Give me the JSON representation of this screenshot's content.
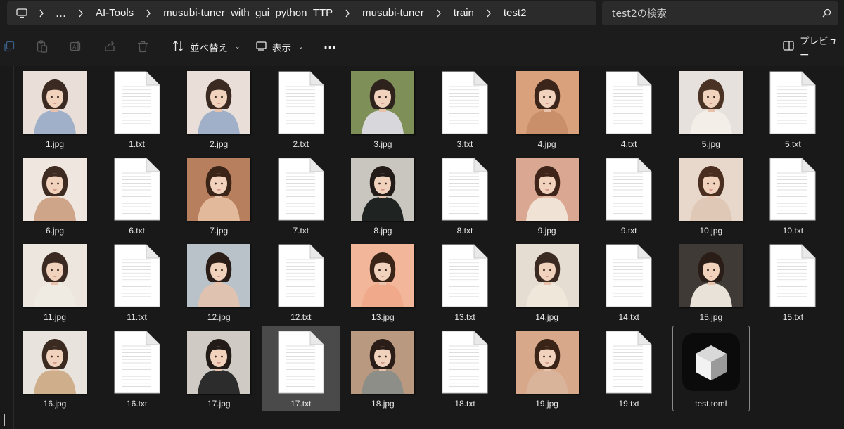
{
  "address": {
    "overflow_label": "…",
    "crumbs": [
      "AI-Tools",
      "musubi-tuner_with_gui_python_TTP",
      "musubi-tuner",
      "train",
      "test2"
    ]
  },
  "search": {
    "placeholder": "test2の検索"
  },
  "toolbar": {
    "sort_label": "並べ替え",
    "view_label": "表示",
    "more_label": "···",
    "preview_label": "プレビュー"
  },
  "files": [
    {
      "name": "1.jpg",
      "type": "image",
      "bg": "#e9dfd8",
      "cloth": "#9fb0c8",
      "hair": "#3a2a22"
    },
    {
      "name": "1.txt",
      "type": "text"
    },
    {
      "name": "2.jpg",
      "type": "image",
      "bg": "#e9dfd8",
      "cloth": "#9fb0c8",
      "hair": "#3a2a22"
    },
    {
      "name": "2.txt",
      "type": "text"
    },
    {
      "name": "3.jpg",
      "type": "image",
      "bg": "#7f8f58",
      "cloth": "#d8d8dc",
      "hair": "#2d221c"
    },
    {
      "name": "3.txt",
      "type": "text"
    },
    {
      "name": "4.jpg",
      "type": "image",
      "bg": "#d9a27c",
      "cloth": "#c98e6a",
      "hair": "#3b2419"
    },
    {
      "name": "4.txt",
      "type": "text"
    },
    {
      "name": "5.jpg",
      "type": "image",
      "bg": "#e6e1dc",
      "cloth": "#f3efe8",
      "hair": "#4a3325"
    },
    {
      "name": "5.txt",
      "type": "text"
    },
    {
      "name": "6.jpg",
      "type": "image",
      "bg": "#efe6df",
      "cloth": "#cfa58a",
      "hair": "#3d2a20"
    },
    {
      "name": "6.txt",
      "type": "text"
    },
    {
      "name": "7.jpg",
      "type": "image",
      "bg": "#b87f5e",
      "cloth": "#e2b99a",
      "hair": "#3a2418"
    },
    {
      "name": "7.txt",
      "type": "text"
    },
    {
      "name": "8.jpg",
      "type": "image",
      "bg": "#c9c6c0",
      "cloth": "#1f2422",
      "hair": "#231b17"
    },
    {
      "name": "8.txt",
      "type": "text"
    },
    {
      "name": "9.jpg",
      "type": "image",
      "bg": "#d9a792",
      "cloth": "#f1e2d6",
      "hair": "#3f2419"
    },
    {
      "name": "9.txt",
      "type": "text"
    },
    {
      "name": "10.jpg",
      "type": "image",
      "bg": "#e8d8cc",
      "cloth": "#e0c8b6",
      "hair": "#4a2e20"
    },
    {
      "name": "10.txt",
      "type": "text"
    },
    {
      "name": "11.jpg",
      "type": "image",
      "bg": "#ece6de",
      "cloth": "#f0ebe2",
      "hair": "#3a2a22"
    },
    {
      "name": "11.txt",
      "type": "text"
    },
    {
      "name": "12.jpg",
      "type": "image",
      "bg": "#b9c2c9",
      "cloth": "#e0c2b0",
      "hair": "#2a1c16"
    },
    {
      "name": "12.txt",
      "type": "text"
    },
    {
      "name": "13.jpg",
      "type": "image",
      "bg": "#f2b79a",
      "cloth": "#f0a98a",
      "hair": "#3a2418"
    },
    {
      "name": "13.txt",
      "type": "text"
    },
    {
      "name": "14.jpg",
      "type": "image",
      "bg": "#e6ddd2",
      "cloth": "#eee7da",
      "hair": "#3a2a22"
    },
    {
      "name": "14.txt",
      "type": "text"
    },
    {
      "name": "15.jpg",
      "type": "image",
      "bg": "#3f3a36",
      "cloth": "#e8e2d8",
      "hair": "#2a1c16"
    },
    {
      "name": "15.txt",
      "type": "text"
    },
    {
      "name": "16.jpg",
      "type": "image",
      "bg": "#e8e3dc",
      "cloth": "#cfae8c",
      "hair": "#3b2a20"
    },
    {
      "name": "16.txt",
      "type": "text"
    },
    {
      "name": "17.jpg",
      "type": "image",
      "bg": "#cfcac4",
      "cloth": "#2c2c2c",
      "hair": "#231b17"
    },
    {
      "name": "17.txt",
      "type": "text",
      "selected": true
    },
    {
      "name": "18.jpg",
      "type": "image",
      "bg": "#b99a80",
      "cloth": "#8e8e88",
      "hair": "#2a1c16"
    },
    {
      "name": "18.txt",
      "type": "text"
    },
    {
      "name": "19.jpg",
      "type": "image",
      "bg": "#d7a88a",
      "cloth": "#d9b39a",
      "hair": "#3a2418"
    },
    {
      "name": "19.txt",
      "type": "text"
    },
    {
      "name": "test.toml",
      "type": "toml",
      "focused": true
    }
  ]
}
